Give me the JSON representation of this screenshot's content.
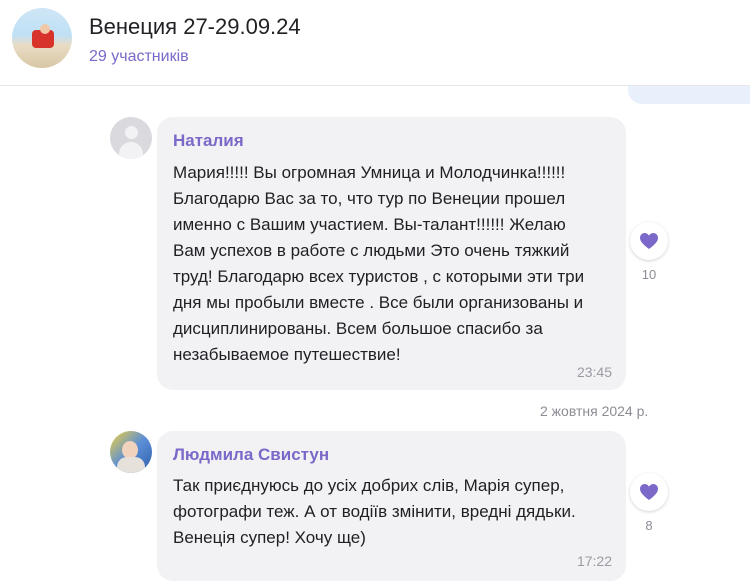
{
  "header": {
    "title": "Венеция 27-29.09.24",
    "members": "29 участників"
  },
  "messages": [
    {
      "sender": "Наталия",
      "lines": [
        "Мария!!!!! Вы огромная Умница и Молодчинка!!!!!!",
        "Благодарю Вас за то, что тур по Венеции прошел",
        "именно с Вашим участием. Вы-талант!!!!!! Желаю",
        "Вам успехов в работе с людьми Это очень тяжкий",
        "труд! Благодарю всех туристов , с которыми эти три",
        "дня мы пробыли вместе . Все были организованы и",
        "дисциплинированы. Всем большое спасибо за",
        "незабываемое путешествие!"
      ],
      "time": "23:45",
      "reaction_count": "10",
      "reaction_color": "#7b68c8"
    },
    {
      "sender": "Людмила Свистун",
      "lines": [
        "Так приєднуюсь до усіх добрих слів, Марія супер,",
        "фотографи теж. А от водіїв змінити, вредні дядьки.",
        "Венеція супер! Хочу ще)"
      ],
      "time": "17:22",
      "reaction_count": "8",
      "reaction_color": "#7b68c8"
    }
  ],
  "date_separator": "2 жовтня 2024 р.",
  "icons": {
    "reaction": "heart-icon",
    "default_avatar": "user-placeholder-icon"
  },
  "colors": {
    "accent": "#7b68c8",
    "bubble": "#f2f2f5",
    "outgoing_bubble": "#e8f0fb"
  }
}
